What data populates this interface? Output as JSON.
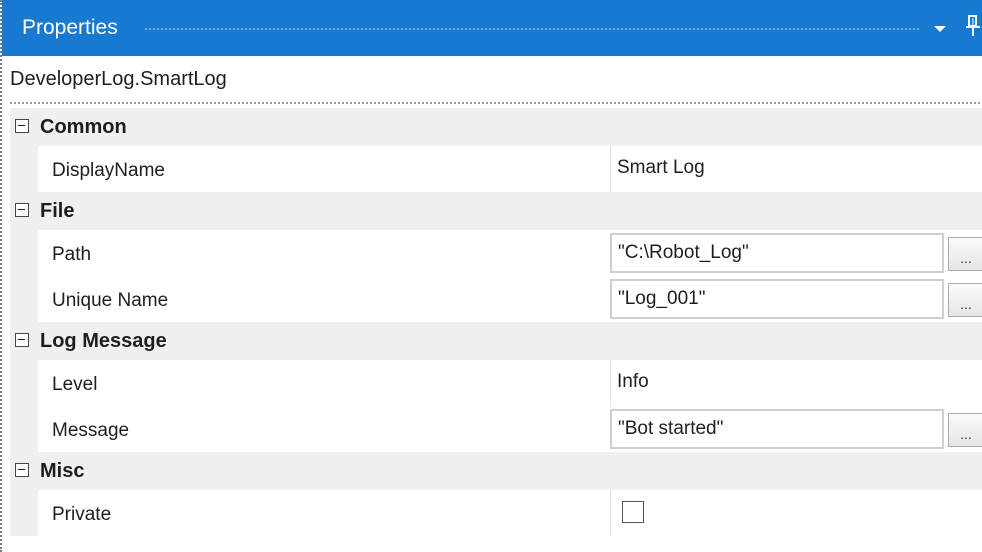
{
  "panel": {
    "title": "Properties",
    "icons": [
      "chevron-down-icon",
      "pin-icon"
    ]
  },
  "object_name": "DeveloperLog.SmartLog",
  "categories": [
    {
      "label": "Common",
      "properties": [
        {
          "name": "DisplayName",
          "value": "Smart Log",
          "kind": "text"
        }
      ]
    },
    {
      "label": "File",
      "properties": [
        {
          "name": "Path",
          "value": "\"C:\\Robot_Log\"",
          "kind": "expression",
          "button": "..."
        },
        {
          "name": "Unique Name",
          "value": "\"Log_001\"",
          "kind": "expression",
          "button": "..."
        }
      ]
    },
    {
      "label": "Log Message",
      "properties": [
        {
          "name": "Level",
          "value": "Info",
          "kind": "text"
        },
        {
          "name": "Message",
          "value": "\"Bot started\"",
          "kind": "expression",
          "button": "..."
        }
      ]
    },
    {
      "label": "Misc",
      "properties": [
        {
          "name": "Private",
          "value": false,
          "kind": "checkbox"
        }
      ]
    }
  ],
  "colors": {
    "title_bar": "#1779d0",
    "category_bg": "#f0f0f0"
  }
}
